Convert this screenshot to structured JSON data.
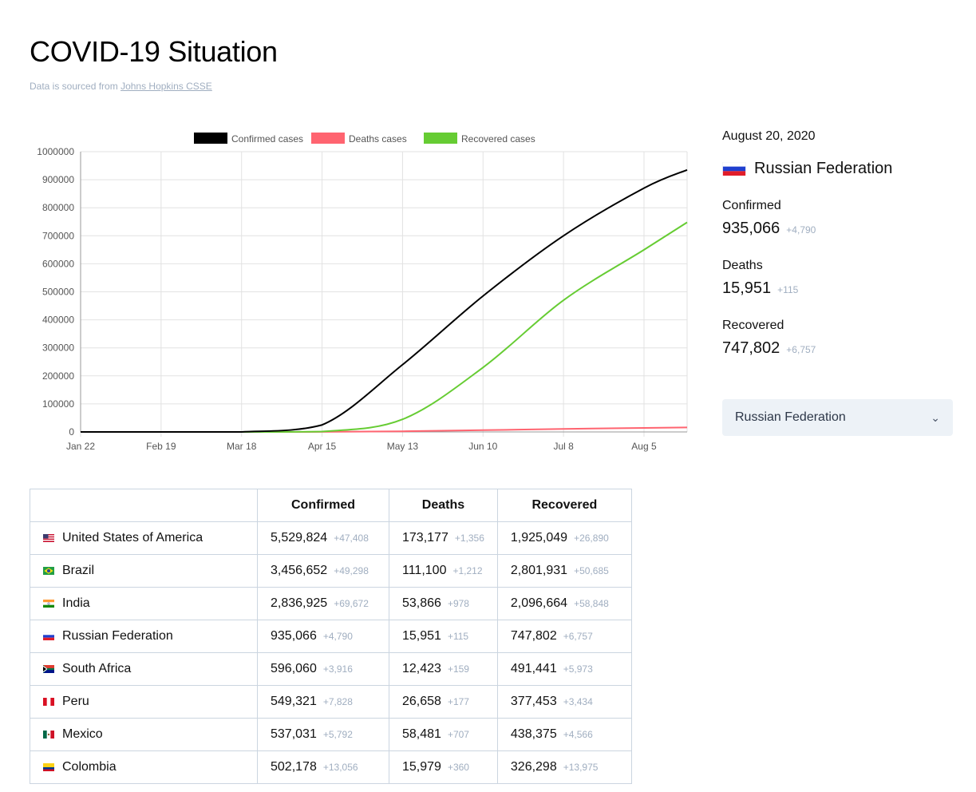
{
  "header": {
    "title": "COVID-19 Situation",
    "subtitle_prefix": "Data is sourced from",
    "source_link": "Johns Hopkins CSSE"
  },
  "chart_data": {
    "type": "line",
    "x": [
      "Jan 22",
      "Feb 19",
      "Mar 18",
      "Apr 15",
      "May 13",
      "Jun 10",
      "Jul 8",
      "Aug 5",
      "Aug 20"
    ],
    "x_tick_labels": [
      "Jan 22",
      "Feb 19",
      "Mar 18",
      "Apr 15",
      "May 13",
      "Jun 10",
      "Jul 8",
      "Aug 5"
    ],
    "ylim": [
      0,
      1000000
    ],
    "y_ticks": [
      "0",
      "100000",
      "200000",
      "300000",
      "400000",
      "500000",
      "600000",
      "700000",
      "800000",
      "900000",
      "1000000"
    ],
    "grid": true,
    "legend_position": "top",
    "series": [
      {
        "name": "Confirmed cases",
        "color": "#000000",
        "values": [
          0,
          5,
          150,
          25000,
          240000,
          485000,
          700000,
          870000,
          935066
        ]
      },
      {
        "name": "Deaths cases",
        "color": "#ff6470",
        "values": [
          0,
          0,
          0,
          200,
          2300,
          6300,
          10700,
          14300,
          15951
        ]
      },
      {
        "name": "Recovered cases",
        "color": "#66cc33",
        "values": [
          0,
          0,
          10,
          1500,
          45000,
          230000,
          470000,
          650000,
          747802
        ]
      }
    ]
  },
  "sidebar": {
    "date": "August 20, 2020",
    "country": "Russian Federation",
    "stats": [
      {
        "label": "Confirmed",
        "value": "935,066",
        "delta": "+4,790"
      },
      {
        "label": "Deaths",
        "value": "15,951",
        "delta": "+115"
      },
      {
        "label": "Recovered",
        "value": "747,802",
        "delta": "+6,757"
      }
    ],
    "select_value": "Russian Federation"
  },
  "table": {
    "headers": [
      "",
      "Confirmed",
      "Deaths",
      "Recovered"
    ],
    "rows": [
      {
        "country": "United States of America",
        "flag": "us-flag",
        "confirmed": "5,529,824",
        "confirmed_delta": "+47,408",
        "deaths": "173,177",
        "deaths_delta": "+1,356",
        "recovered": "1,925,049",
        "recovered_delta": "+26,890"
      },
      {
        "country": "Brazil",
        "flag": "br-flag",
        "confirmed": "3,456,652",
        "confirmed_delta": "+49,298",
        "deaths": "111,100",
        "deaths_delta": "+1,212",
        "recovered": "2,801,931",
        "recovered_delta": "+50,685"
      },
      {
        "country": "India",
        "flag": "in-flag",
        "confirmed": "2,836,925",
        "confirmed_delta": "+69,672",
        "deaths": "53,866",
        "deaths_delta": "+978",
        "recovered": "2,096,664",
        "recovered_delta": "+58,848"
      },
      {
        "country": "Russian Federation",
        "flag": "ru-flag",
        "confirmed": "935,066",
        "confirmed_delta": "+4,790",
        "deaths": "15,951",
        "deaths_delta": "+115",
        "recovered": "747,802",
        "recovered_delta": "+6,757"
      },
      {
        "country": "South Africa",
        "flag": "za-flag",
        "confirmed": "596,060",
        "confirmed_delta": "+3,916",
        "deaths": "12,423",
        "deaths_delta": "+159",
        "recovered": "491,441",
        "recovered_delta": "+5,973"
      },
      {
        "country": "Peru",
        "flag": "pe-flag",
        "confirmed": "549,321",
        "confirmed_delta": "+7,828",
        "deaths": "26,658",
        "deaths_delta": "+177",
        "recovered": "377,453",
        "recovered_delta": "+3,434"
      },
      {
        "country": "Mexico",
        "flag": "mx-flag",
        "confirmed": "537,031",
        "confirmed_delta": "+5,792",
        "deaths": "58,481",
        "deaths_delta": "+707",
        "recovered": "438,375",
        "recovered_delta": "+4,566"
      },
      {
        "country": "Colombia",
        "flag": "co-flag",
        "confirmed": "502,178",
        "confirmed_delta": "+13,056",
        "deaths": "15,979",
        "deaths_delta": "+360",
        "recovered": "326,298",
        "recovered_delta": "+13,975"
      }
    ]
  }
}
